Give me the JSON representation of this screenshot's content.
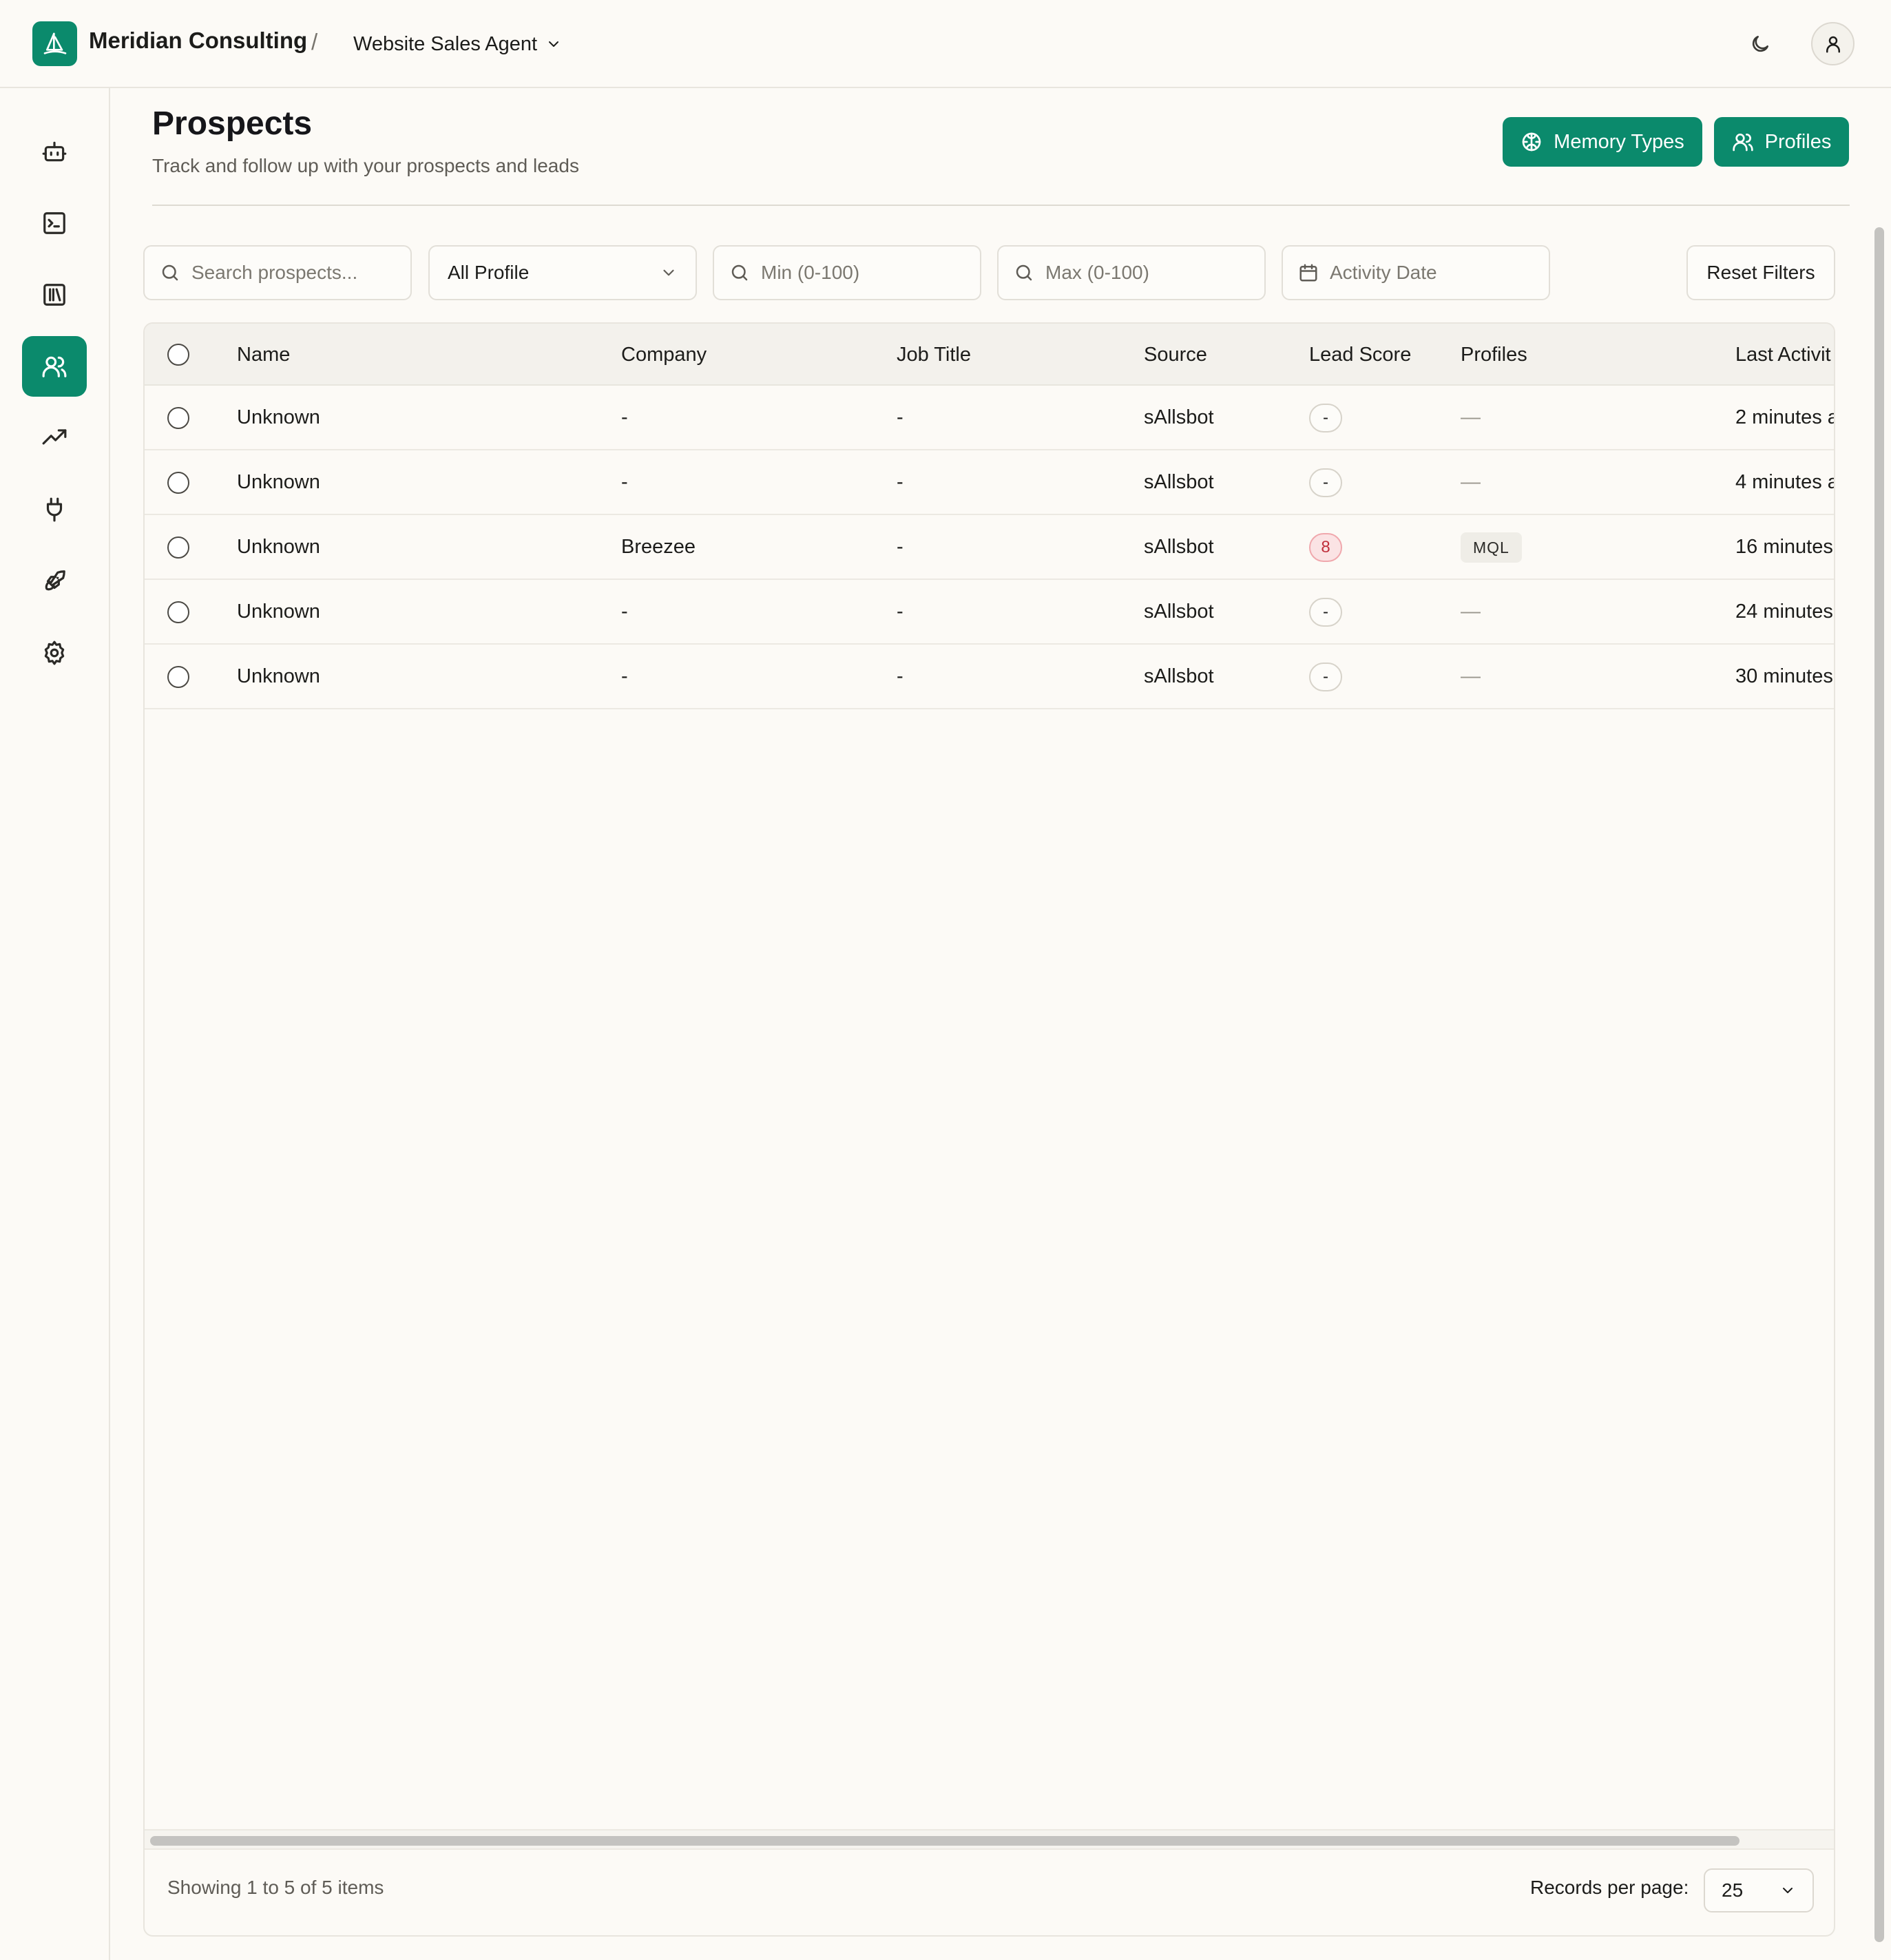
{
  "app": {
    "brand": "Meridian Consulting",
    "separator": "/",
    "agent": "Website Sales Agent"
  },
  "colors": {
    "accent": "#0b8a6c",
    "background": "#fcfaf6",
    "hot_score_bg": "#fbe3e4",
    "hot_score_text": "#c0303c"
  },
  "sidebar": {
    "items": [
      {
        "icon": "bot-icon",
        "active": false
      },
      {
        "icon": "terminal-icon",
        "active": false
      },
      {
        "icon": "library-icon",
        "active": false
      },
      {
        "icon": "users-icon",
        "active": true
      },
      {
        "icon": "trending-up-icon",
        "active": false
      },
      {
        "icon": "plug-icon",
        "active": false
      },
      {
        "icon": "rocket-icon",
        "active": false
      },
      {
        "icon": "settings-icon",
        "active": false
      }
    ]
  },
  "header": {
    "title": "Prospects",
    "subtitle": "Track and follow up with your prospects and leads",
    "memory_types_label": "Memory Types",
    "profiles_label": "Profiles"
  },
  "filters": {
    "search_placeholder": "Search prospects...",
    "profile_selected": "All Profile",
    "min_placeholder": "Min (0-100)",
    "max_placeholder": "Max (0-100)",
    "date_placeholder": "Activity Date",
    "reset_label": "Reset Filters"
  },
  "table": {
    "columns": {
      "name": "Name",
      "company": "Company",
      "job_title": "Job Title",
      "source": "Source",
      "lead_score": "Lead Score",
      "profiles": "Profiles",
      "last_activity": "Last Activit"
    },
    "rows": [
      {
        "name": "Unknown",
        "company": "-",
        "job_title": "-",
        "source": "sAllsbot",
        "lead_score": "-",
        "profiles": "—",
        "last_activity": "2 minutes a"
      },
      {
        "name": "Unknown",
        "company": "-",
        "job_title": "-",
        "source": "sAllsbot",
        "lead_score": "-",
        "profiles": "—",
        "last_activity": "4 minutes a"
      },
      {
        "name": "Unknown",
        "company": "Breezee",
        "job_title": "-",
        "source": "sAllsbot",
        "lead_score": "8",
        "profiles": "MQL",
        "last_activity": "16 minutes"
      },
      {
        "name": "Unknown",
        "company": "-",
        "job_title": "-",
        "source": "sAllsbot",
        "lead_score": "-",
        "profiles": "—",
        "last_activity": "24 minutes"
      },
      {
        "name": "Unknown",
        "company": "-",
        "job_title": "-",
        "source": "sAllsbot",
        "lead_score": "-",
        "profiles": "—",
        "last_activity": "30 minutes"
      }
    ]
  },
  "footer": {
    "showing": "Showing 1 to 5 of 5 items",
    "records_label": "Records per page:",
    "records_value": "25"
  }
}
